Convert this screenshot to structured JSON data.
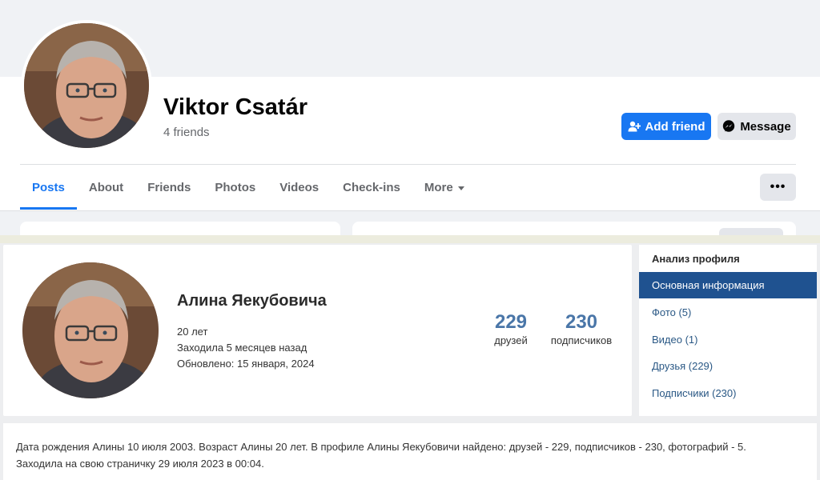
{
  "profile": {
    "name": "Viktor Csatár",
    "friends_count_text": "4 friends"
  },
  "actions": {
    "add_friend_label": "Add friend",
    "message_label": "Message",
    "more_options_label": "•••"
  },
  "tabs": [
    {
      "label": "Posts",
      "active": true
    },
    {
      "label": "About"
    },
    {
      "label": "Friends"
    },
    {
      "label": "Photos"
    },
    {
      "label": "Videos"
    },
    {
      "label": "Check-ins"
    },
    {
      "label": "More"
    }
  ],
  "analysis": {
    "name": "Алина Яекубовича",
    "age": "20 лет",
    "last_seen": "Заходила 5 месяцев назад",
    "updated": "Обновлено: 15 января, 2024",
    "stats": [
      {
        "value": "229",
        "label": "друзей"
      },
      {
        "value": "230",
        "label": "подписчиков"
      }
    ]
  },
  "side_menu": {
    "title": "Анализ профиля",
    "items": [
      {
        "label": "Основная информация",
        "active": true
      },
      {
        "label": "Фото (5)"
      },
      {
        "label": "Видео (1)"
      },
      {
        "label": "Друзья (229)"
      },
      {
        "label": "Подписчики (230)"
      }
    ]
  },
  "bio": {
    "line1": "Дата рождения Алины 10 июля 2003. Возраст Алины 20 лет. В профиле Алины Яекубовичи найдено: друзей - 229, подписчиков - 230, фотографий - 5.",
    "line2": "Заходила на свою страничку 29 июля 2023 в 00:04."
  },
  "colors": {
    "primary": "#1877f2",
    "stat_blue": "#4a76a8",
    "menu_active": "#1f5290",
    "link": "#2a5885"
  }
}
